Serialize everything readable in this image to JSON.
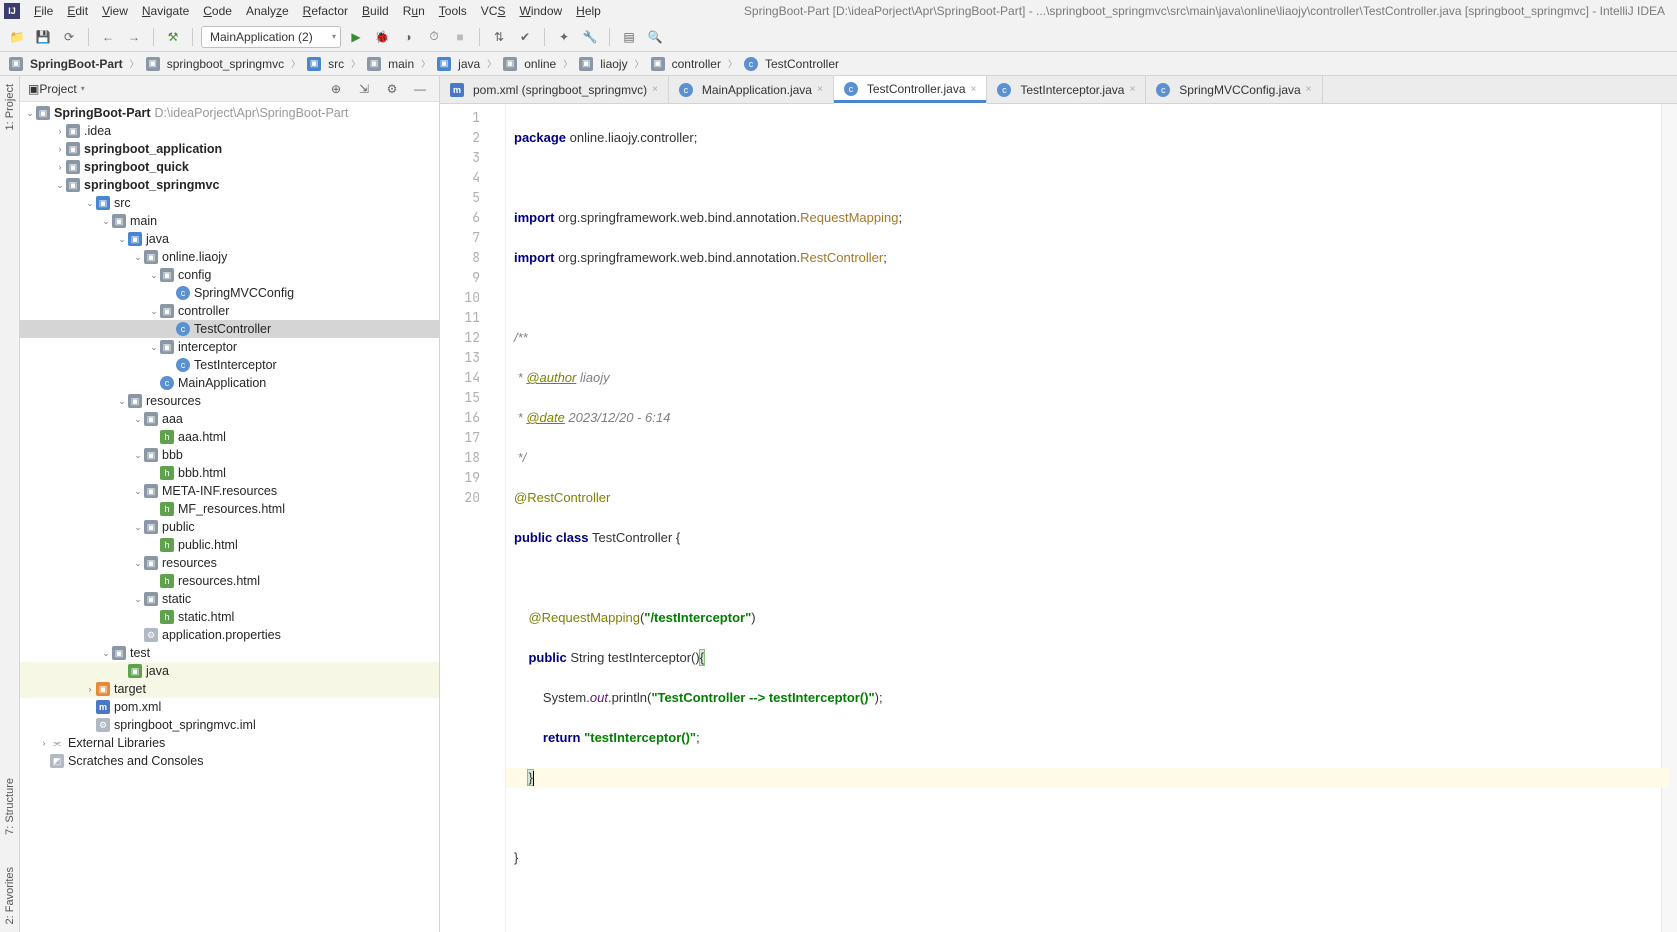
{
  "app_icon": "IJ",
  "title": "SpringBoot-Part [D:\\ideaPorject\\Apr\\SpringBoot-Part] - ...\\springboot_springmvc\\src\\main\\java\\online\\liaojy\\controller\\TestController.java [springboot_springmvc] - IntelliJ IDEA",
  "menu": [
    "File",
    "Edit",
    "View",
    "Navigate",
    "Code",
    "Analyze",
    "Refactor",
    "Build",
    "Run",
    "Tools",
    "VCS",
    "Window",
    "Help"
  ],
  "run_config": "MainApplication (2)",
  "breadcrumb": [
    "SpringBoot-Part",
    "springboot_springmvc",
    "src",
    "main",
    "java",
    "online",
    "liaojy",
    "controller",
    "TestController"
  ],
  "panel_title": "Project",
  "left_tabs": [
    "1: Project",
    "7: Structure",
    "2: Favorites"
  ],
  "tree": {
    "root": {
      "name": "SpringBoot-Part",
      "path": "D:\\ideaPorject\\Apr\\SpringBoot-Part"
    },
    "n_idea": ".idea",
    "n_app": "springboot_application",
    "n_quick": "springboot_quick",
    "n_mvc": "springboot_springmvc",
    "n_src": "src",
    "n_main": "main",
    "n_java": "java",
    "n_pkg": "online.liaojy",
    "n_config": "config",
    "n_smvc": "SpringMVCConfig",
    "n_ctrl": "controller",
    "n_tc": "TestController",
    "n_intc": "interceptor",
    "n_ti": "TestInterceptor",
    "n_mainapp": "MainApplication",
    "n_res": "resources",
    "n_aaa": "aaa",
    "n_aaah": "aaa.html",
    "n_bbb": "bbb",
    "n_bbbh": "bbb.html",
    "n_meta": "META-INF.resources",
    "n_metah": "MF_resources.html",
    "n_pub": "public",
    "n_pubh": "public.html",
    "n_res2": "resources",
    "n_resh": "resources.html",
    "n_static": "static",
    "n_statich": "static.html",
    "n_appprop": "application.properties",
    "n_test": "test",
    "n_testjava": "java",
    "n_target": "target",
    "n_pom": "pom.xml",
    "n_iml": "springboot_springmvc.iml",
    "n_ext": "External Libraries",
    "n_scratch": "Scratches and Consoles"
  },
  "tabs": [
    {
      "label": "pom.xml (springboot_springmvc)",
      "icon": "m"
    },
    {
      "label": "MainApplication.java",
      "icon": "c"
    },
    {
      "label": "TestController.java",
      "icon": "c",
      "active": true
    },
    {
      "label": "TestInterceptor.java",
      "icon": "c"
    },
    {
      "label": "SpringMVCConfig.java",
      "icon": "c"
    }
  ],
  "code": {
    "line_count": 19,
    "l1_kw": "package",
    "l1_rest": " online.liaojy.controller;",
    "l3_kw": "import",
    "l3_mid": " org.springframework.web.bind.annotation.",
    "l3_cls": "RequestMapping",
    "l3_end": ";",
    "l4_kw": "import",
    "l4_mid": " org.springframework.web.bind.annotation.",
    "l4_cls": "RestController",
    "l4_end": ";",
    "l6": "/**",
    "l7_pre": " * ",
    "l7_tag": "@author",
    "l7_rest": " liaojy",
    "l8_pre": " * ",
    "l8_tag": "@date",
    "l8_rest": " 2023/12/20 - 6:14",
    "l9": " */",
    "l10": "@RestController",
    "l11_kw1": "public ",
    "l11_kw2": "class ",
    "l11_name": "TestController {",
    "l13_ind": "    ",
    "l13_ann": "@RequestMapping",
    "l13_p1": "(",
    "l13_str": "\"/testInterceptor\"",
    "l13_p2": ")",
    "l14_ind": "    ",
    "l14_kw": "public ",
    "l14_type": "String ",
    "l14_rest": "testInterceptor()",
    "l14_brace": "{",
    "l15_ind": "        ",
    "l15_a": "System.",
    "l15_out": "out",
    "l15_b": ".println(",
    "l15_str": "\"TestController --> testInterceptor()\"",
    "l15_c": ");",
    "l16_ind": "        ",
    "l16_kw": "return ",
    "l16_str": "\"testInterceptor()\"",
    "l16_end": ";",
    "l17_ind": "    ",
    "l17_brace": "}",
    "l19": "}"
  }
}
